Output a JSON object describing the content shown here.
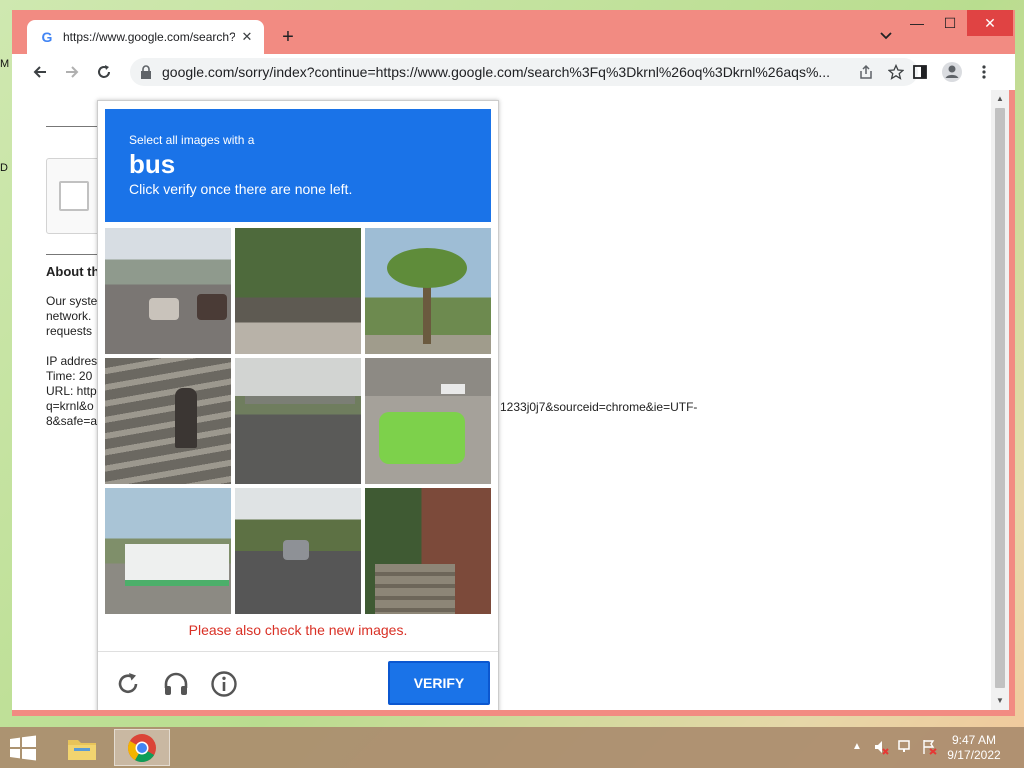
{
  "desktop": {
    "clip_top": "M",
    "clip_mid": "D"
  },
  "browser": {
    "tab": {
      "title": "https://www.google.com/search?q",
      "favicon": "G"
    },
    "new_tab_label": "+",
    "url": "google.com/sorry/index?continue=https://www.google.com/search%3Fq%3Dkrnl%26oq%3Dkrnl%26aqs%...",
    "window_controls": {
      "minimize": "—",
      "maximize": "☐",
      "close": "✕"
    }
  },
  "page": {
    "about_heading": "About th",
    "para1": [
      "Our syste",
      "network.",
      "requests"
    ],
    "para2": [
      "IP addres",
      "Time: 20",
      "URL: http",
      "q=krnl&o",
      "8&safe=a"
    ],
    "url_tail": "1233j0j7&sourceid=chrome&ie=UTF-"
  },
  "captcha": {
    "instruction_line1": "Select all images with a",
    "target": "bus",
    "instruction_line2": "Click verify once there are none left.",
    "tiles": [
      "street-with-cars",
      "trees-and-fence",
      "palm-tree",
      "stone-steps",
      "highway-overpass",
      "green-taxi",
      "intersection-with-bus",
      "road-with-car",
      "brick-steps"
    ],
    "error_message": "Please also check the new images.",
    "verify_label": "VERIFY",
    "colors": {
      "header": "#1a73e8",
      "error": "#d93025"
    }
  },
  "taskbar": {
    "time": "9:47 AM",
    "date": "9/17/2022"
  }
}
